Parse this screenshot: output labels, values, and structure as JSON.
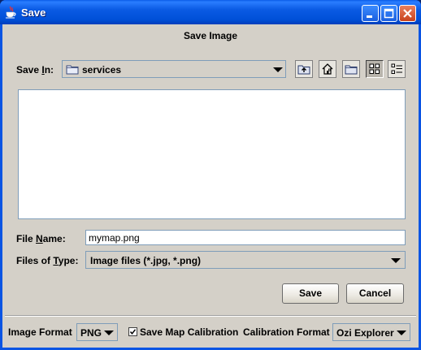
{
  "window": {
    "title": "Save",
    "heading": "Save Image"
  },
  "location": {
    "save_in_label_pre": "Save ",
    "save_in_label_mnemonic": "I",
    "save_in_label_post": "n:",
    "current_folder": "services",
    "icons": [
      "folder-icon",
      "up-folder-icon",
      "home-icon",
      "new-folder-icon",
      "list-view-icon",
      "details-view-icon"
    ]
  },
  "file": {
    "name_label_pre": "File ",
    "name_label_mnemonic": "N",
    "name_label_post": "ame:",
    "name_value": "mymap.png",
    "type_label_pre": "Files of ",
    "type_label_mnemonic": "T",
    "type_label_post": "ype:",
    "type_value": "Image files (*.jpg, *.png)"
  },
  "buttons": {
    "save": "Save",
    "cancel": "Cancel"
  },
  "options": {
    "image_format_label": "Image Format",
    "image_format_value": "PNG",
    "save_calibration_label": "Save Map Calibration",
    "save_calibration_checked": true,
    "calibration_format_label": "Calibration Format",
    "calibration_format_value": "Ozi Explorer"
  },
  "colors": {
    "title_bar": "#0a54e3",
    "dialog_bg": "#d4d0c8",
    "field_border": "#7f9db9"
  }
}
